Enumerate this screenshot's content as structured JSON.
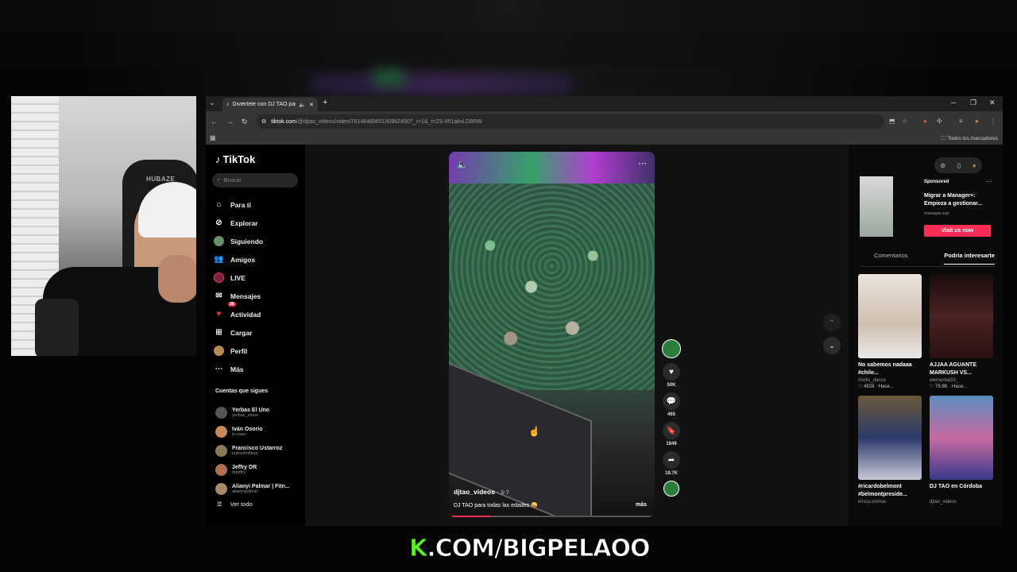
{
  "browser": {
    "tab_title": "Diviértete con DJ TAO para",
    "url_host": "tiktok.com",
    "url_path": "/@djtao_videos/video/7614648965190962450?_r=1&_t=ZS-951akvLD8RW",
    "bookmarks_label": "Todos los marcadores"
  },
  "tiktok": {
    "logo": "TikTok",
    "search_placeholder": "Buscar",
    "nav": [
      {
        "label": "Para ti",
        "icon": "home-icon"
      },
      {
        "label": "Explorar",
        "icon": "compass-icon"
      },
      {
        "label": "Siguiendo",
        "icon": "avatar-icon"
      },
      {
        "label": "Amigos",
        "icon": "friends-icon"
      },
      {
        "label": "LIVE",
        "icon": "live-icon"
      },
      {
        "label": "Mensajes",
        "icon": "message-icon"
      },
      {
        "label": "Actividad",
        "icon": "activity-icon",
        "badge": "38"
      },
      {
        "label": "Cargar",
        "icon": "upload-icon"
      },
      {
        "label": "Perfil",
        "icon": "profile-icon"
      },
      {
        "label": "Más",
        "icon": "more-icon"
      }
    ],
    "following_header": "Cuentas que sigues",
    "following": [
      {
        "name": "Yerbas El Uno",
        "user": "yerbas_eluno"
      },
      {
        "name": "Iván Osorio",
        "user": "iv.vaan"
      },
      {
        "name": "Francisco Ustarroz",
        "user": "nutricionfitust"
      },
      {
        "name": "Jeffry DR",
        "user": "drjeffry"
      },
      {
        "name": "Alianyi Palmar | Fitn...",
        "user": "alianyipalmar"
      }
    ],
    "see_all": "Ver todo",
    "video": {
      "username": "djtao_videos",
      "date": "· 3-7",
      "caption": "DJ TAO para todas las edades 😜",
      "more": "más",
      "progress": 0.2
    },
    "actions": {
      "likes": "50K",
      "comments": "465",
      "saves": "1849",
      "shares": "18.7K"
    },
    "ad": {
      "sponsored": "Sponsored",
      "title": "Migrar a Manager+: Empieza a gestionar...",
      "source": "manager-erp",
      "button": "Visit us now"
    },
    "tabs": [
      "Comentarios",
      "Podría interesarte"
    ],
    "cards": [
      {
        "title": "No sabemos nadaaa #chile...",
        "user": "mollis_dance",
        "stat": "♡ 4928 · Hace..."
      },
      {
        "title": "AJJAA AGUANTE MARKUSH VS...",
        "user": "elemental33_",
        "stat": "♡ 79.8K · Hace..."
      },
      {
        "title": "#ricardobelmont #belmontpreside...",
        "user": "krissy.sinmas",
        "stat": ""
      },
      {
        "title": "DJ TAO en Córdoba",
        "user": "djtao_videos",
        "stat": ""
      }
    ]
  },
  "overlay": {
    "kick_prefix": "K",
    "kick_text": ".COM/BIGPELAOO"
  },
  "colors": {
    "tiktok_red": "#fe2c55",
    "kick_green": "#53fc18"
  }
}
